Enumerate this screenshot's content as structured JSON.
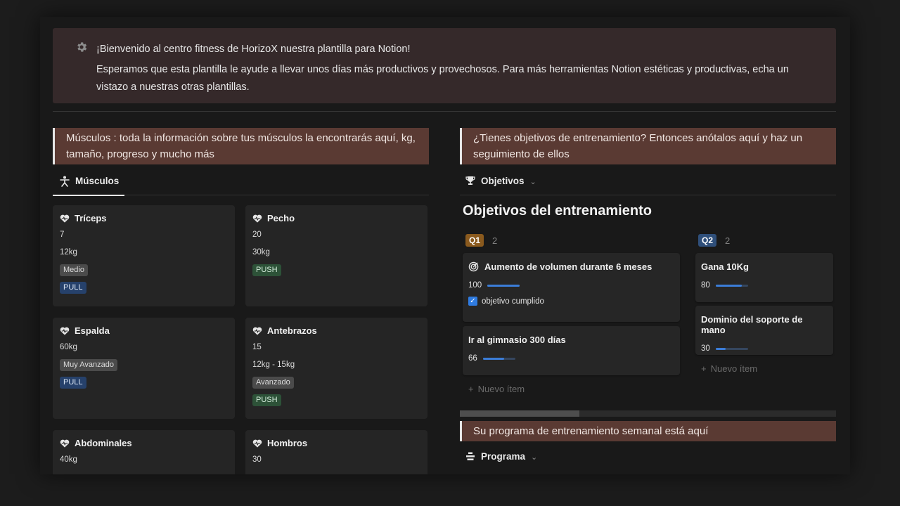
{
  "callout": {
    "icon": "gear-icon",
    "title": "¡Bienvenido al centro fitness de HorizoX nuestra plantilla para Notion!",
    "text": "Esperamos que esta plantilla le ayude a llevar unos días más productivos y provechosos. Para más herramientas Notion estéticas y productivas, echa un vistazo a nuestras otras plantillas."
  },
  "left": {
    "quote": "Músculos : toda la información sobre tus músculos la encontrarás aquí, kg, tamaño, progreso y mucho más",
    "tab": {
      "icon": "person-icon",
      "label": "Músculos"
    },
    "cards": [
      {
        "title": "Tríceps",
        "lines": [
          "7",
          "12kg"
        ],
        "tags": [
          {
            "label": "Medio",
            "color": "gray"
          },
          {
            "label": "PULL",
            "color": "blue"
          }
        ]
      },
      {
        "title": "Pecho",
        "lines": [
          "20",
          "30kg"
        ],
        "tags": [
          {
            "label": "PUSH",
            "color": "green"
          }
        ]
      },
      {
        "title": "Espalda",
        "lines": [
          "60kg"
        ],
        "tags": [
          {
            "label": "Muy Avanzado",
            "color": "gray"
          },
          {
            "label": "PULL",
            "color": "blue"
          }
        ]
      },
      {
        "title": "Antebrazos",
        "lines": [
          "15",
          "12kg - 15kg"
        ],
        "tags": [
          {
            "label": "Avanzado",
            "color": "gray"
          },
          {
            "label": "PUSH",
            "color": "green"
          }
        ]
      },
      {
        "title": "Abdominales",
        "lines": [
          "40kg"
        ],
        "tags": []
      },
      {
        "title": "Hombros",
        "lines": [
          "30"
        ],
        "tags": []
      }
    ]
  },
  "right": {
    "quote": "¿Tienes objetivos de entrenamiento? Entonces anótalos aquí y haz un seguimiento de ellos",
    "tab": {
      "icon": "trophy-icon",
      "label": "Objetivos",
      "chevron": "⌄"
    },
    "board_title": "Objetivos del entrenamiento",
    "groups": [
      {
        "label": "Q1",
        "count": "2",
        "cards": [
          {
            "title": "Aumento de volumen durante 6 meses",
            "icon": "target-icon",
            "progress": "100",
            "progress_fraction": 1.0,
            "checkbox": "objetivo cumplido"
          },
          {
            "title": "Ir al gimnasio 300 días",
            "progress": "66",
            "progress_fraction": 0.66
          }
        ],
        "new_item": "Nuevo ítem"
      },
      {
        "label": "Q2",
        "count": "2",
        "cards": [
          {
            "title": "Gana 10Kg",
            "progress": "80",
            "progress_fraction": 0.8
          },
          {
            "title": "Dominio del soporte de mano",
            "progress": "30",
            "progress_fraction": 0.3
          }
        ],
        "new_item": "Nuevo ítem"
      }
    ],
    "quote2": "Su programa de entrenamiento semanal está aquí",
    "tab2": {
      "icon": "program-icon",
      "label": "Programa",
      "chevron": "⌄"
    }
  }
}
